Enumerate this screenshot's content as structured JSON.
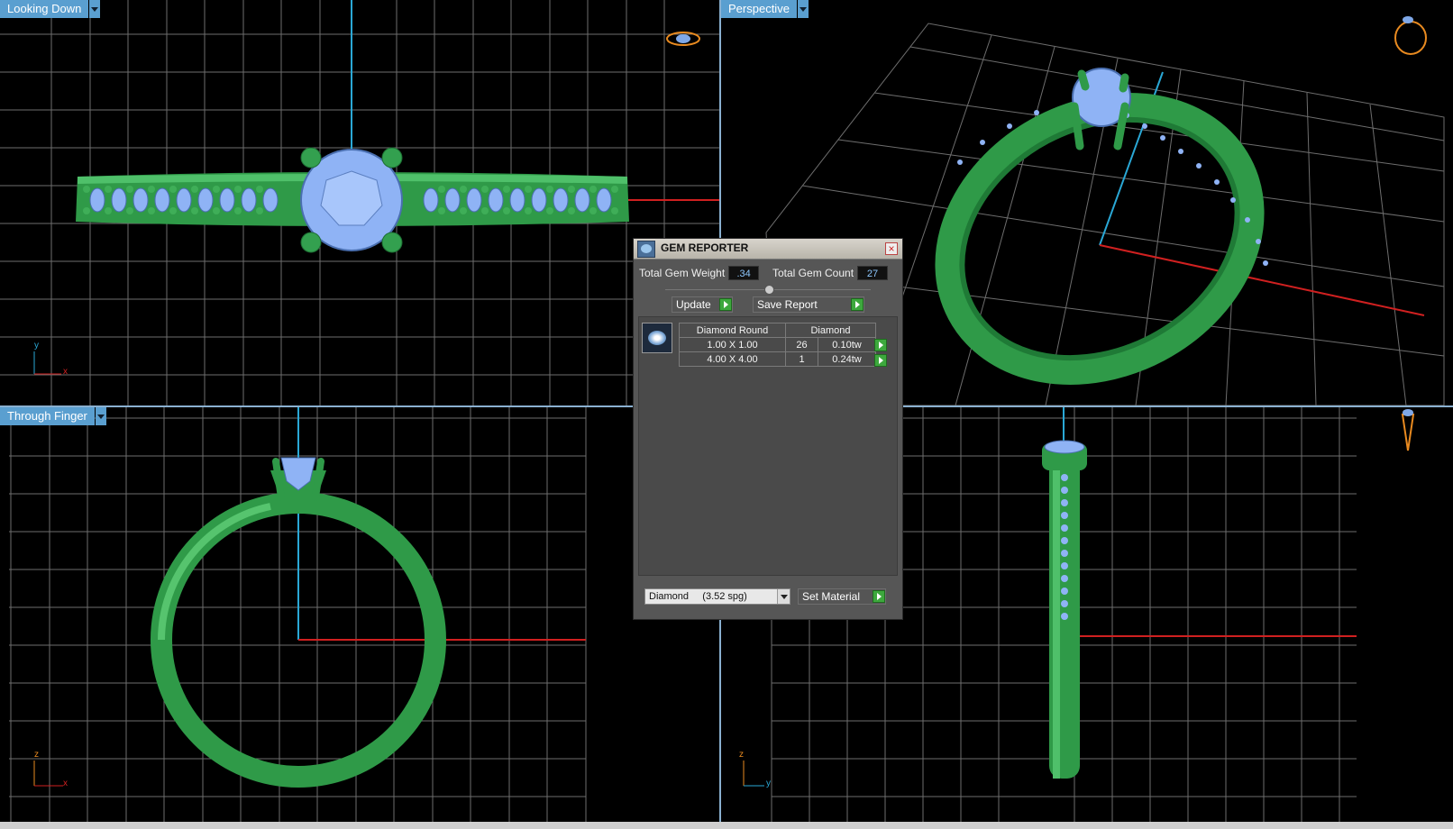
{
  "viewports": {
    "top_left": {
      "label": "Looking Down",
      "axis_a": "y",
      "axis_b": "x"
    },
    "top_right": {
      "label": "Perspective"
    },
    "bottom_left": {
      "label": "Through Finger",
      "axis_a": "z",
      "axis_b": "x"
    },
    "bottom_right": {
      "axis_a": "z",
      "axis_b": "y"
    }
  },
  "colors": {
    "ring": "#2f9a48",
    "gem": "#8fb3f5",
    "axis_blue": "#2aa8d6",
    "axis_red": "#d02020",
    "grid": "#6e6e6e",
    "label_bg": "#5a9fd0"
  },
  "icons": {
    "dialog": "gem-reporter-icon",
    "close": "close-icon",
    "go": "play-arrow-icon",
    "dropdown": "chevron-down-icon"
  },
  "gem_reporter": {
    "title": "GEM REPORTER",
    "total_weight_label": "Total Gem Weight",
    "total_weight_value": ".34",
    "total_count_label": "Total Gem Count",
    "total_count_value": "27",
    "update_label": "Update",
    "save_label": "Save Report",
    "table": {
      "header_shape": "Diamond Round",
      "header_material": "Diamond",
      "rows": [
        {
          "size": "1.00 X 1.00",
          "count": "26",
          "weight": "0.10tw"
        },
        {
          "size": "4.00 X 4.00",
          "count": "1",
          "weight": "0.24tw"
        }
      ]
    },
    "material_select": "Diamond     (3.52 spg)",
    "set_material_label": "Set Material"
  }
}
